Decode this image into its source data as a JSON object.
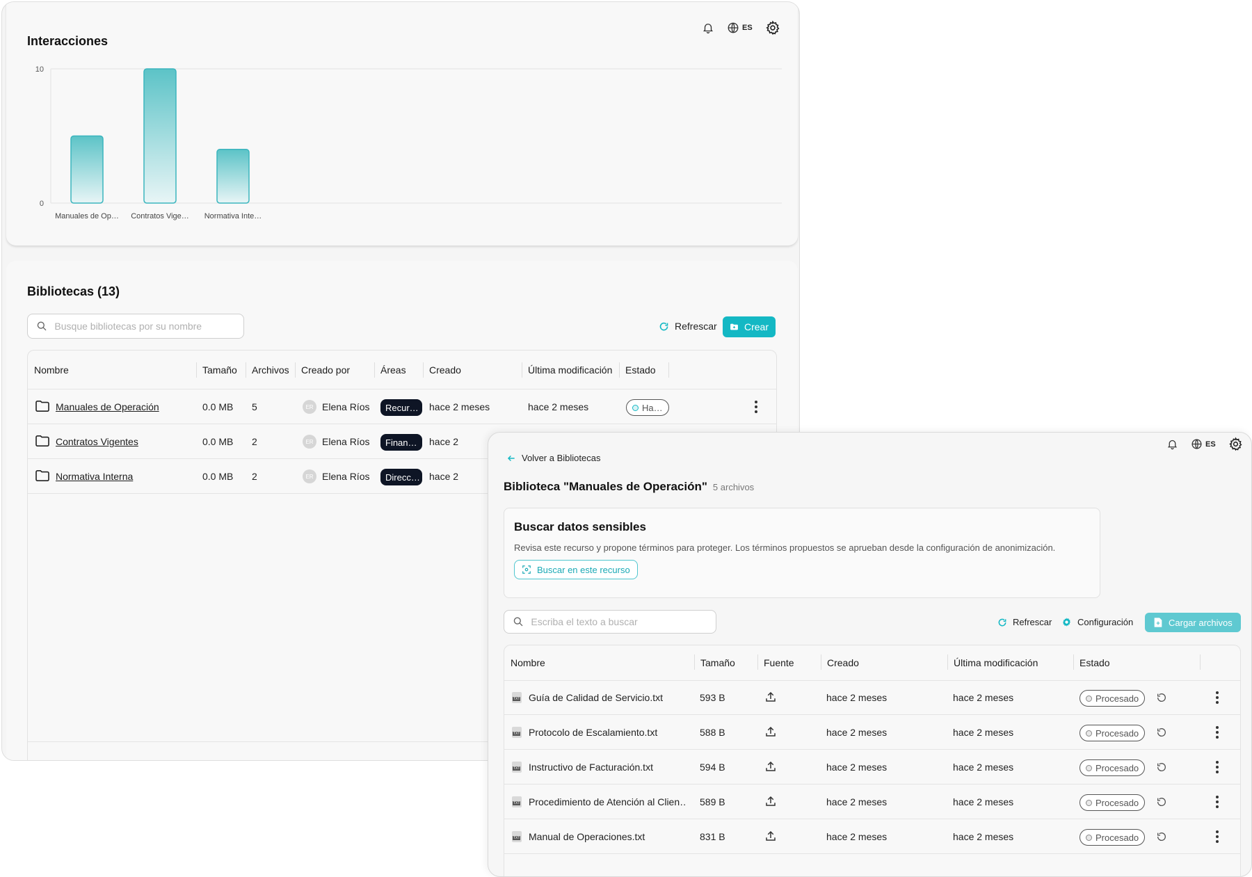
{
  "app": {
    "lang": "ES"
  },
  "chart": {
    "title": "Interacciones",
    "chart_data": {
      "type": "bar",
      "categories": [
        "Manuales de Op…",
        "Contratos Vige…",
        "Normativa Inte…"
      ],
      "values": [
        5,
        10,
        4
      ],
      "ylim": [
        0,
        10
      ],
      "yticks": [
        "0",
        "10"
      ],
      "grid": true,
      "colors": {
        "bar_top": "#5cc3c7",
        "bar_bottom": "#e8f5f6",
        "bar_stroke": "#3bb5be"
      }
    }
  },
  "libraries": {
    "title": "Bibliotecas (13)",
    "search_placeholder": "Busque bibliotecas por su nombre",
    "refresh_label": "Refrescar",
    "create_label": "Crear",
    "columns": [
      "Nombre",
      "Tamaño",
      "Archivos",
      "Creado por",
      "Áreas",
      "Creado",
      "Última modificación",
      "Estado"
    ],
    "rows": [
      {
        "name": "Manuales de Operación",
        "size": "0.0 MB",
        "files": "5",
        "initials": "ER",
        "creator": "Elena Ríos",
        "area": "Recur…",
        "created": "hace 2 meses",
        "modified": "hace 2 meses",
        "status": "Ha…"
      },
      {
        "name": "Contratos Vigentes",
        "size": "0.0 MB",
        "files": "2",
        "initials": "ER",
        "creator": "Elena Ríos",
        "area": "Finan…",
        "created": "hace 2",
        "modified": "",
        "status": ""
      },
      {
        "name": "Normativa Interna",
        "size": "0.0 MB",
        "files": "2",
        "initials": "ER",
        "creator": "Elena Ríos",
        "area": "Direcc…",
        "created": "hace 2",
        "modified": "",
        "status": ""
      }
    ]
  },
  "detail": {
    "back_label": "Volver a Bibliotecas",
    "title": "Biblioteca \"Manuales de Operación\"",
    "file_count": "5 archivos",
    "sensitive": {
      "title": "Buscar datos sensibles",
      "description": "Revisa este recurso y propone términos para proteger. Los términos propuestos se aprueban desde la configuración de anonimización.",
      "button": "Buscar en este recurso"
    },
    "search_placeholder": "Escriba el texto a buscar",
    "refresh_label": "Refrescar",
    "config_label": "Configuración",
    "upload_label": "Cargar archivos",
    "columns": [
      "Nombre",
      "Tamaño",
      "Fuente",
      "Creado",
      "Última modificación",
      "Estado"
    ],
    "rows": [
      {
        "name": "Guía de Calidad de Servicio.txt",
        "size": "593 B",
        "created": "hace 2 meses",
        "modified": "hace 2 meses",
        "status": "Procesado"
      },
      {
        "name": "Protocolo de Escalamiento.txt",
        "size": "588 B",
        "created": "hace 2 meses",
        "modified": "hace 2 meses",
        "status": "Procesado"
      },
      {
        "name": "Instructivo de Facturación.txt",
        "size": "594 B",
        "created": "hace 2 meses",
        "modified": "hace 2 meses",
        "status": "Procesado"
      },
      {
        "name": "Procedimiento de Atención al Clien…",
        "size": "589 B",
        "created": "hace 2 meses",
        "modified": "hace 2 meses",
        "status": "Procesado"
      },
      {
        "name": "Manual de Operaciones.txt",
        "size": "831 B",
        "created": "hace 2 meses",
        "modified": "hace 2 meses",
        "status": "Procesado"
      }
    ]
  }
}
